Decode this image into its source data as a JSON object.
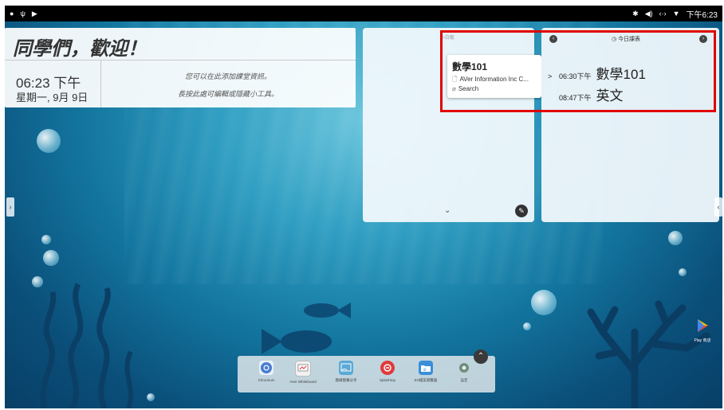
{
  "status_bar": {
    "left_icons": [
      "dot-icon",
      "usb-icon",
      "play-icon"
    ],
    "right_icons": [
      "bluetooth-icon",
      "volume-icon",
      "ethernet-icon",
      "wifi-icon"
    ],
    "time": "下午6:23"
  },
  "welcome": {
    "title": "同學們，歡迎！",
    "time": "06:23 下午",
    "date": "星期一, 9月 9日",
    "info_line1": "您可以在此添加課堂資訊。",
    "info_line2": "長按此處可編輯或隱藏小工具。"
  },
  "whiteboard": {
    "title": "小白板",
    "popup": {
      "title": "數學101",
      "row1": "AVer Information Inc  C...",
      "row2": "Search"
    }
  },
  "schedule": {
    "title": "今日課表",
    "items": [
      {
        "caret": ">",
        "time": "06:30下午",
        "subject": "數學101"
      },
      {
        "caret": "",
        "time": "08:47下午",
        "subject": "英文"
      }
    ]
  },
  "dock": {
    "items": [
      {
        "label": "Chromium",
        "icon": "chromium-icon"
      },
      {
        "label": "AVer Whiteboard",
        "icon": "whiteboard-icon"
      },
      {
        "label": "無線螢幕分享",
        "icon": "screen-share-icon"
      },
      {
        "label": "Splashtop",
        "icon": "splashtop-icon"
      },
      {
        "label": "ES檔案瀏覽器",
        "icon": "file-explorer-icon"
      },
      {
        "label": "設定",
        "icon": "settings-icon"
      }
    ]
  },
  "play_store": {
    "label": "Play 商店"
  },
  "colors": {
    "highlight": "#e00000",
    "ocean": "#13769f"
  }
}
